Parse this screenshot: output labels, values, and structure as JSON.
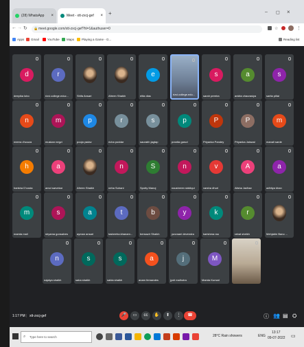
{
  "tabs": [
    {
      "label": "(28) WhatsApp",
      "color": "#25d366"
    },
    {
      "label": "Meet - xtt-zxcj-gef",
      "color": "#00897b"
    }
  ],
  "new_tab_symbol": "+",
  "url": "meet.google.com/xtt-zxcj-gef?hl=1&authuser=0",
  "bookmarks": [
    {
      "label": "Apps",
      "color": "#4285f4"
    },
    {
      "label": "Gmail",
      "color": "#ea4335"
    },
    {
      "label": "YouTube",
      "color": "#ff0000"
    },
    {
      "label": "Maps",
      "color": "#34a853"
    },
    {
      "label": "Playing a Game - G...",
      "color": "#fbbc05"
    }
  ],
  "reading_list": "Reading list",
  "participants": [
    {
      "name": "deepika lobo",
      "initial": "d",
      "color": "#d81b60"
    },
    {
      "name": "rizvi.college.educ...",
      "initial": "r",
      "color": "#5c6bc0"
    },
    {
      "name": "Shifa Ansari",
      "initial": "",
      "color": "photo"
    },
    {
      "name": "Afreen Shaikh",
      "initial": "",
      "color": "photo"
    },
    {
      "name": "elita dias",
      "initial": "e",
      "color": "#039be5"
    },
    {
      "name": "rizvi.college.edu...",
      "initial": "",
      "color": "cam"
    },
    {
      "name": "sarah pereira",
      "initial": "s",
      "color": "#d81b60"
    },
    {
      "name": "ankita chaurasiya",
      "initial": "a",
      "color": "#558b2f"
    },
    {
      "name": "sarita pillai",
      "initial": "s",
      "color": "#8e24aa"
    },
    {
      "name": "meera d'souza",
      "initial": "n",
      "color": "#e64a19"
    },
    {
      "name": "muskan negvi",
      "initial": "m",
      "color": "#ad1457"
    },
    {
      "name": "pooja yadav",
      "initial": "p",
      "color": "#1e88e5"
    },
    {
      "name": "richa poddar",
      "initial": "r",
      "color": "#78909c"
    },
    {
      "name": "saurabh jagtap",
      "initial": "s",
      "color": "#78909c"
    },
    {
      "name": "pranita garud",
      "initial": "p",
      "color": "#00897b"
    },
    {
      "name": "Priyanka Pandey",
      "initial": "P",
      "color": "#bf360c"
    },
    {
      "name": "Priyanka Jaiswal",
      "initial": "P",
      "color": "#8d6e63"
    },
    {
      "name": "manali sarde",
      "initial": "m",
      "color": "#e64a19"
    },
    {
      "name": "harisha D'costa",
      "initial": "h",
      "color": "#f57c00"
    },
    {
      "name": "amol sarvekar",
      "initial": "a",
      "color": "#ec407a"
    },
    {
      "name": "Afreen Shaikh",
      "initial": "",
      "color": "photo"
    },
    {
      "name": "neha Suhani",
      "initial": "n",
      "color": "#c2185b"
    },
    {
      "name": "Spotty Manoj",
      "initial": "S",
      "color": "#2e7d32"
    },
    {
      "name": "naushreen siddiqui",
      "initial": "n",
      "color": "#c2185b"
    },
    {
      "name": "varsha dhuri",
      "initial": "v",
      "color": "#e53935"
    },
    {
      "name": "Alisha Jadhav",
      "initial": "A",
      "color": "#ec407a"
    },
    {
      "name": "adhtiya khan",
      "initial": "a",
      "color": "#8e24aa"
    },
    {
      "name": "mamta mali",
      "initial": "m",
      "color": "#00897b"
    },
    {
      "name": "shyama gonsalves",
      "initial": "s",
      "color": "#ad1457"
    },
    {
      "name": "ayman ansari",
      "initial": "a",
      "color": "#00838f"
    },
    {
      "name": "tasbeeha.khanam...",
      "initial": "t",
      "color": "#5c6bc0"
    },
    {
      "name": "bensazir Shaikh",
      "initial": "b",
      "color": "#6d4c41"
    },
    {
      "name": "yuvraani devendra",
      "initial": "y",
      "color": "#8e24aa"
    },
    {
      "name": "karishma rao",
      "initial": "k",
      "color": "#00897b"
    },
    {
      "name": "rahat sheikh",
      "initial": "r",
      "color": "#558b2f"
    },
    {
      "name": "Mehjabin Bano ...",
      "initial": "",
      "color": "photo"
    },
    {
      "name": "najaiya shaikh",
      "initial": "n",
      "color": "#5c6bc0"
    },
    {
      "name": "saba shaikh",
      "initial": "s",
      "color": "#00695c"
    },
    {
      "name": "sabia shaikh",
      "initial": "s",
      "color": "#00695c"
    },
    {
      "name": "anam fernandes",
      "initial": "a",
      "color": "#f4511e"
    },
    {
      "name": "jyoti malhotra",
      "initial": "j",
      "color": "#546e7a"
    },
    {
      "name": "Mamta Kumari",
      "initial": "M",
      "color": "#7e57c2"
    },
    {
      "name": "",
      "initial": "",
      "color": "cam2"
    }
  ],
  "meeting_time": "1:17 PM",
  "meeting_code": "xtt-zxcj-gef",
  "controls": [
    "mic-icon",
    "camera-icon",
    "captions-icon",
    "raise-hand-icon",
    "present-icon",
    "more-icon",
    "end-call-icon"
  ],
  "right_controls": [
    "info-icon",
    "people-icon",
    "chat-icon",
    "activities-icon"
  ],
  "search_placeholder": "Type here to search",
  "system_tray": {
    "weather": "28°C Rain showers",
    "lang": "ENG",
    "time": "13:17",
    "date": "09-07-2022"
  }
}
